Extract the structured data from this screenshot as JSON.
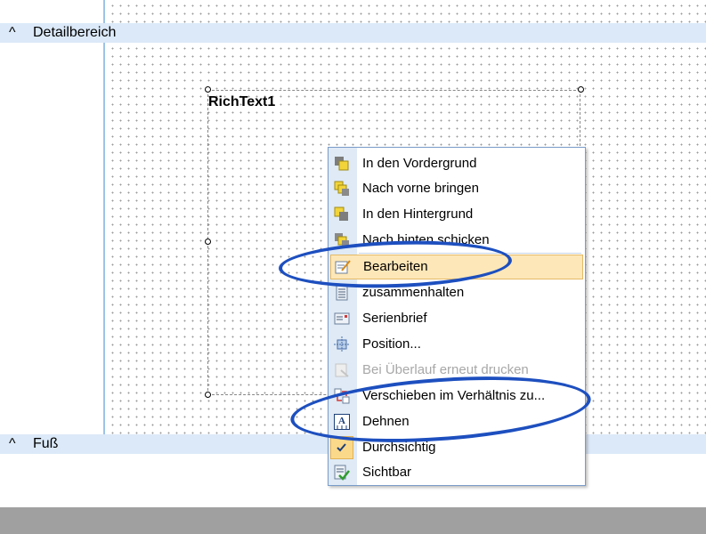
{
  "sections": {
    "detail": {
      "caret": "^",
      "label": "Detailbereich"
    },
    "footer": {
      "caret": "^",
      "label": "Fuß"
    }
  },
  "control": {
    "name": "RichText1"
  },
  "context_menu": {
    "items": [
      {
        "label": "In  den  Vordergrund",
        "icon": "bring-to-front-icon",
        "enabled": true
      },
      {
        "label": "Nach vorne bringen",
        "icon": "bring-forward-icon",
        "enabled": true
      },
      {
        "label": "In den Hintergrund",
        "icon": "send-to-back-icon",
        "enabled": true
      },
      {
        "label": "Nach hinten schicken",
        "icon": "send-backward-icon",
        "enabled": true
      },
      {
        "label": "Bearbeiten",
        "icon": "edit-icon",
        "enabled": true,
        "highlighted": true
      },
      {
        "label": "zusammenhalten",
        "icon": "keep-together-icon",
        "enabled": true
      },
      {
        "label": "Serienbrief",
        "icon": "mail-merge-icon",
        "enabled": true
      },
      {
        "label": "Position...",
        "icon": "position-icon",
        "enabled": true
      },
      {
        "label": "Bei Überlauf erneut drucken",
        "icon": "reprint-icon",
        "enabled": false
      },
      {
        "label": "Verschieben im Verhältnis zu...",
        "icon": "move-relative-icon",
        "enabled": true
      },
      {
        "label": "Dehnen",
        "icon": "stretch-icon",
        "enabled": true
      },
      {
        "label": "Durchsichtig",
        "icon": "checkmark-icon",
        "enabled": true,
        "checked": true
      },
      {
        "label": "Sichtbar",
        "icon": "visible-check-icon",
        "enabled": true
      }
    ]
  },
  "annotation_color": "#1d4fbf",
  "highlight_color": "#fde7b8"
}
